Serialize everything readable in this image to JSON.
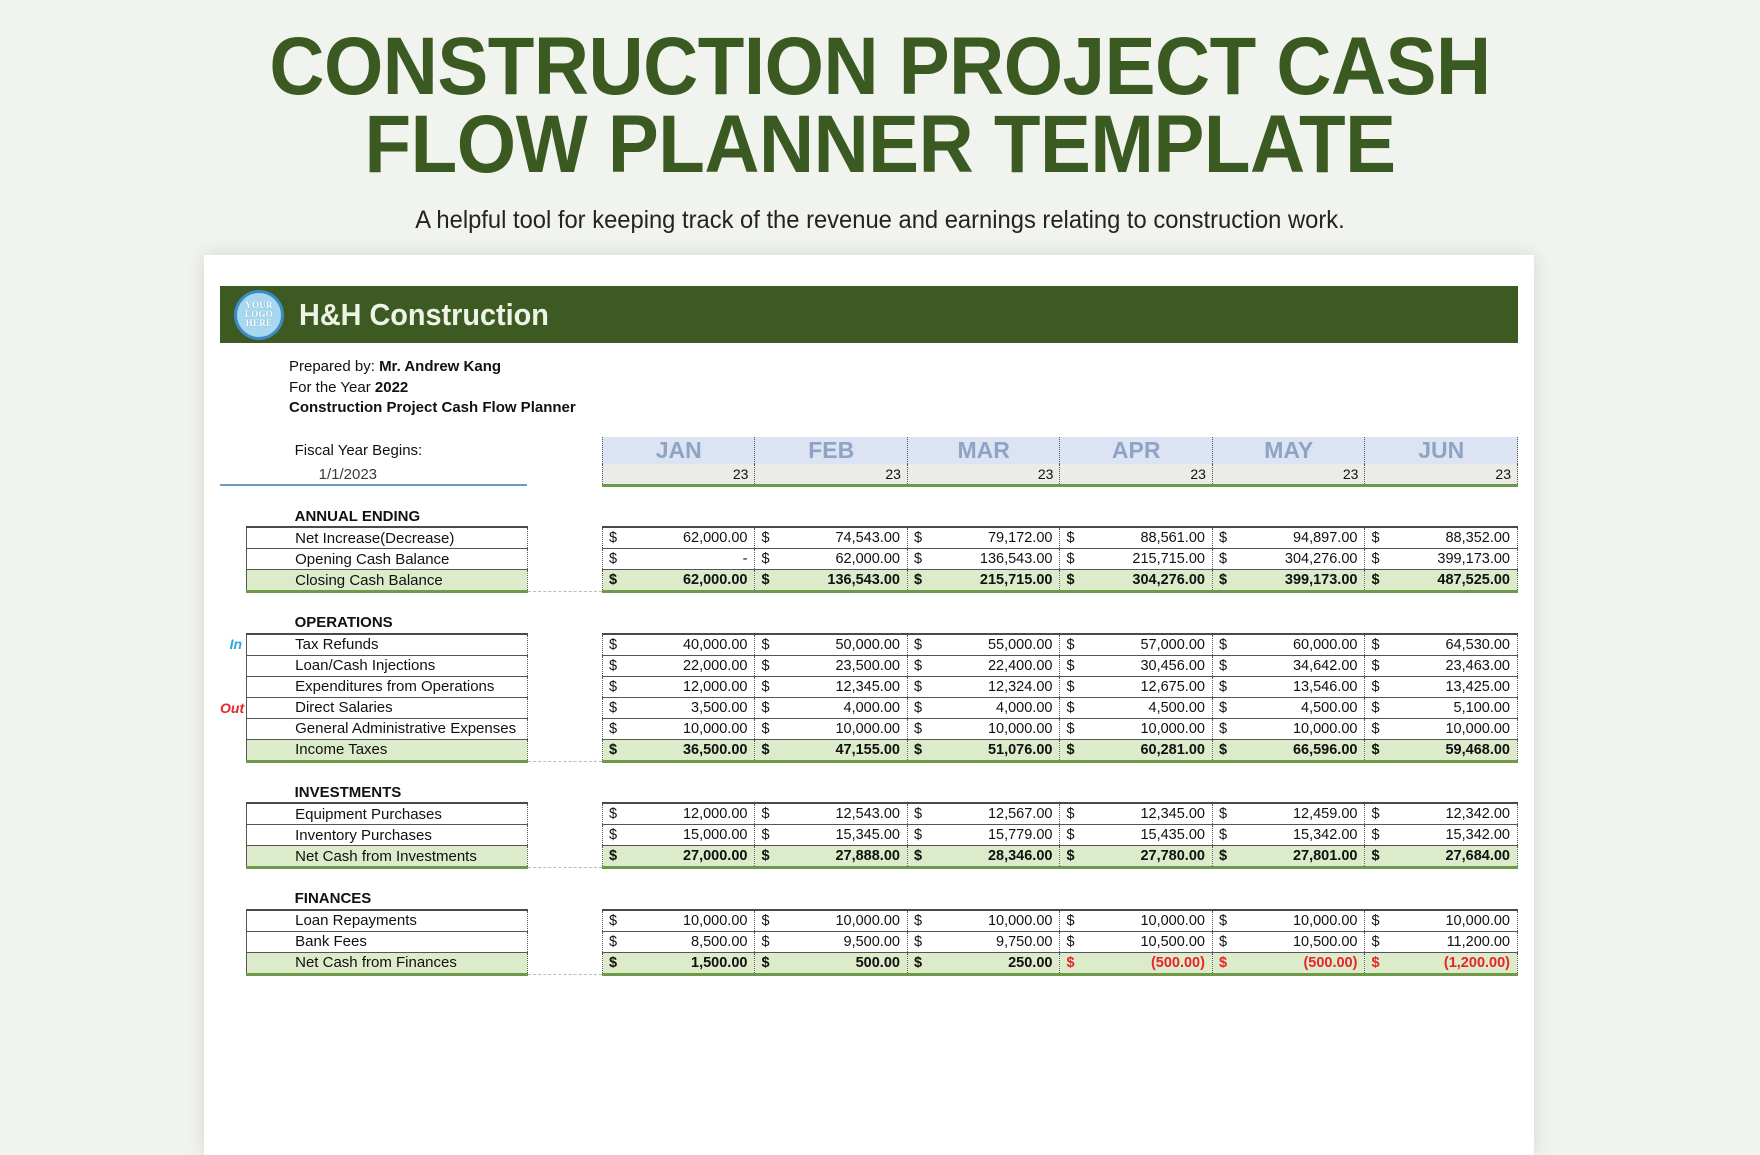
{
  "page": {
    "title": "CONSTRUCTION PROJECT CASH FLOW PLANNER TEMPLATE",
    "subtitle": "A helpful tool for keeping track of the revenue and earnings relating to construction work.",
    "title_color": "#3a5a21",
    "background": "#f1f3ee"
  },
  "header": {
    "logo_text_line1": "YOUR",
    "logo_text_line2": "LOGO",
    "logo_text_line3": "HERE",
    "company": "H&H Construction",
    "bar_color": "#3c5a22"
  },
  "meta": {
    "prepared_by_label": "Prepared by:",
    "prepared_by_value": "Mr. Andrew Kang",
    "year_label": "For the Year",
    "year_value": "2022",
    "doc_label": "Construction Project Cash Flow Planner"
  },
  "fiscal": {
    "label": "Fiscal Year Begins:",
    "date": "1/1/2023"
  },
  "months": [
    "JAN",
    "FEB",
    "MAR",
    "APR",
    "MAY",
    "JUN"
  ],
  "month_years": [
    "23",
    "23",
    "23",
    "23",
    "23",
    "23"
  ],
  "flow_labels": {
    "in": "In",
    "out": "Out"
  },
  "currency_symbol": "$",
  "sections": [
    {
      "title": "ANNUAL ENDING",
      "rows": [
        {
          "label": "Net Increase(Decrease)",
          "flow": "",
          "total": false,
          "values": [
            "62,000.00",
            "74,543.00",
            "79,172.00",
            "88,561.00",
            "94,897.00",
            "88,352.00"
          ],
          "negative": [
            false,
            false,
            false,
            false,
            false,
            false
          ]
        },
        {
          "label": "Opening Cash Balance",
          "flow": "",
          "total": false,
          "values": [
            "-",
            "62,000.00",
            "136,543.00",
            "215,715.00",
            "304,276.00",
            "399,173.00"
          ],
          "negative": [
            false,
            false,
            false,
            false,
            false,
            false
          ]
        },
        {
          "label": "Closing Cash Balance",
          "flow": "",
          "total": true,
          "values": [
            "62,000.00",
            "136,543.00",
            "215,715.00",
            "304,276.00",
            "399,173.00",
            "487,525.00"
          ],
          "negative": [
            false,
            false,
            false,
            false,
            false,
            false
          ]
        }
      ]
    },
    {
      "title": "OPERATIONS",
      "rows": [
        {
          "label": "Tax Refunds",
          "flow": "in",
          "total": false,
          "values": [
            "40,000.00",
            "50,000.00",
            "55,000.00",
            "57,000.00",
            "60,000.00",
            "64,530.00"
          ],
          "negative": [
            false,
            false,
            false,
            false,
            false,
            false
          ]
        },
        {
          "label": "Loan/Cash Injections",
          "flow": "",
          "total": false,
          "values": [
            "22,000.00",
            "23,500.00",
            "22,400.00",
            "30,456.00",
            "34,642.00",
            "23,463.00"
          ],
          "negative": [
            false,
            false,
            false,
            false,
            false,
            false
          ]
        },
        {
          "label": "Expenditures from Operations",
          "flow": "",
          "total": false,
          "values": [
            "12,000.00",
            "12,345.00",
            "12,324.00",
            "12,675.00",
            "13,546.00",
            "13,425.00"
          ],
          "negative": [
            false,
            false,
            false,
            false,
            false,
            false
          ]
        },
        {
          "label": "Direct Salaries",
          "flow": "out",
          "total": false,
          "values": [
            "3,500.00",
            "4,000.00",
            "4,000.00",
            "4,500.00",
            "4,500.00",
            "5,100.00"
          ],
          "negative": [
            false,
            false,
            false,
            false,
            false,
            false
          ]
        },
        {
          "label": "General Administrative Expenses",
          "flow": "",
          "total": false,
          "values": [
            "10,000.00",
            "10,000.00",
            "10,000.00",
            "10,000.00",
            "10,000.00",
            "10,000.00"
          ],
          "negative": [
            false,
            false,
            false,
            false,
            false,
            false
          ]
        },
        {
          "label": "Income Taxes",
          "flow": "",
          "total": true,
          "values": [
            "36,500.00",
            "47,155.00",
            "51,076.00",
            "60,281.00",
            "66,596.00",
            "59,468.00"
          ],
          "negative": [
            false,
            false,
            false,
            false,
            false,
            false
          ]
        }
      ]
    },
    {
      "title": "INVESTMENTS",
      "rows": [
        {
          "label": "Equipment Purchases",
          "flow": "",
          "total": false,
          "values": [
            "12,000.00",
            "12,543.00",
            "12,567.00",
            "12,345.00",
            "12,459.00",
            "12,342.00"
          ],
          "negative": [
            false,
            false,
            false,
            false,
            false,
            false
          ]
        },
        {
          "label": "Inventory Purchases",
          "flow": "",
          "total": false,
          "values": [
            "15,000.00",
            "15,345.00",
            "15,779.00",
            "15,435.00",
            "15,342.00",
            "15,342.00"
          ],
          "negative": [
            false,
            false,
            false,
            false,
            false,
            false
          ]
        },
        {
          "label": "Net Cash from Investments",
          "flow": "",
          "total": true,
          "values": [
            "27,000.00",
            "27,888.00",
            "28,346.00",
            "27,780.00",
            "27,801.00",
            "27,684.00"
          ],
          "negative": [
            false,
            false,
            false,
            false,
            false,
            false
          ]
        }
      ]
    },
    {
      "title": "FINANCES",
      "rows": [
        {
          "label": "Loan Repayments",
          "flow": "",
          "total": false,
          "values": [
            "10,000.00",
            "10,000.00",
            "10,000.00",
            "10,000.00",
            "10,000.00",
            "10,000.00"
          ],
          "negative": [
            false,
            false,
            false,
            false,
            false,
            false
          ]
        },
        {
          "label": "Bank Fees",
          "flow": "",
          "total": false,
          "values": [
            "8,500.00",
            "9,500.00",
            "9,750.00",
            "10,500.00",
            "10,500.00",
            "11,200.00"
          ],
          "negative": [
            false,
            false,
            false,
            false,
            false,
            false
          ]
        },
        {
          "label": "Net Cash from Finances",
          "flow": "",
          "total": true,
          "values": [
            "1,500.00",
            "500.00",
            "250.00",
            "(500.00)",
            "(500.00)",
            "(1,200.00)"
          ],
          "negative": [
            false,
            false,
            false,
            true,
            true,
            true
          ]
        }
      ]
    }
  ]
}
